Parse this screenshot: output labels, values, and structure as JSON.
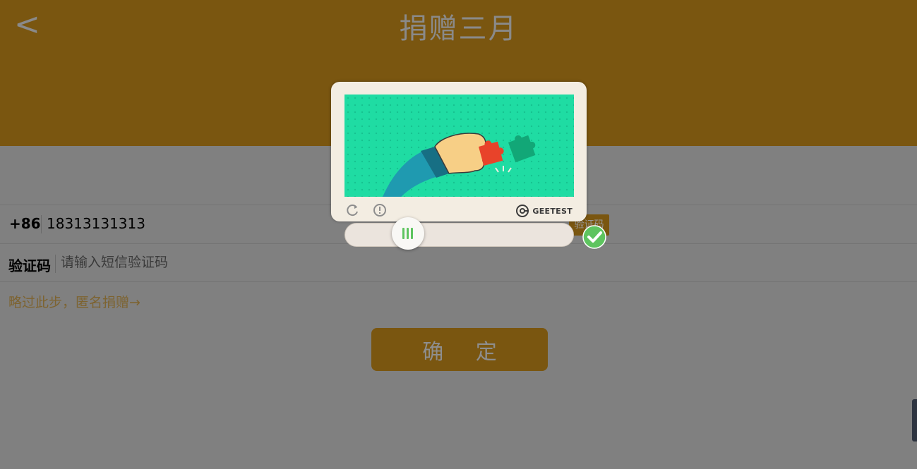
{
  "header": {
    "back_icon": "chevron-left-icon",
    "back_glyph": "<",
    "title": "捐赠三月"
  },
  "form": {
    "country_code": "+86",
    "phone_value": "18313131313",
    "get_code_label": "验证码",
    "code_label": "验证码",
    "code_placeholder": "请输入短信验证码",
    "skip_text": "略过此步，匿名捐赠→",
    "confirm_label": "确 定"
  },
  "captcha": {
    "brand": "GEETEST",
    "refresh_icon": "refresh-icon",
    "feedback_icon": "exclamation-circle-icon",
    "slider_handle_icon": "grip-lines-icon",
    "status_icon": "check-circle-icon",
    "colors": {
      "image_bg": "#1fdca3",
      "puzzle_piece": "#e8432a",
      "puzzle_slot": "#12a777",
      "success": "#5ec45f"
    }
  },
  "colors": {
    "header_bg": "#7a5610",
    "overlay_bg": "#808080",
    "button_bg": "#7a5610"
  }
}
